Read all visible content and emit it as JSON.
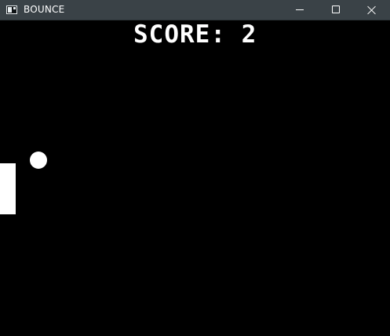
{
  "window": {
    "title": "BOUNCE",
    "controls": {
      "minimize_icon": "minimize-icon",
      "maximize_icon": "maximize-icon",
      "close_icon": "close-icon"
    },
    "app_icon": "window-app-icon"
  },
  "game": {
    "score_text": "SCORE: 2",
    "colors": {
      "background": "#000000",
      "foreground": "#ffffff",
      "titlebar": "#3a4247"
    }
  }
}
